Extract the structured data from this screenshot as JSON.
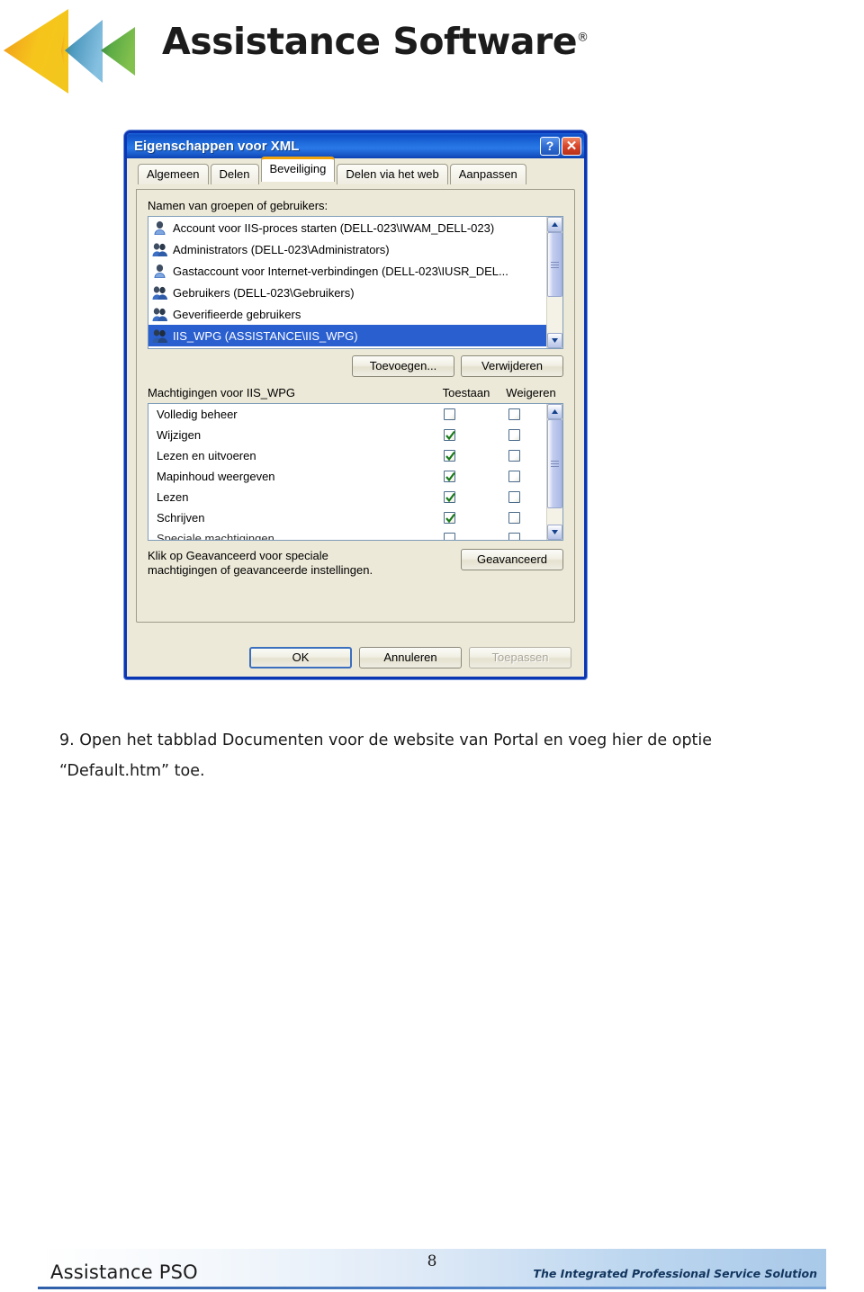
{
  "header": {
    "logo_icon": "assistance-chevron-logo",
    "wordmark": "Assistance Software",
    "registered_mark": "®"
  },
  "dialog": {
    "title": "Eigenschappen voor XML",
    "help_button": "?",
    "close_button": "✕",
    "tabs": [
      {
        "label": "Algemeen",
        "active": false
      },
      {
        "label": "Delen",
        "active": false
      },
      {
        "label": "Beveiliging",
        "active": true
      },
      {
        "label": "Delen via het web",
        "active": false
      },
      {
        "label": "Aanpassen",
        "active": false
      }
    ],
    "groups_label": "Namen van groepen of gebruikers:",
    "groups": [
      {
        "name": "Account voor IIS-proces starten (DELL-023\\IWAM_DELL-023)",
        "icon": "single-user-icon",
        "selected": false
      },
      {
        "name": "Administrators (DELL-023\\Administrators)",
        "icon": "group-users-icon",
        "selected": false
      },
      {
        "name": "Gastaccount voor Internet-verbindingen (DELL-023\\IUSR_DEL...",
        "icon": "single-user-icon",
        "selected": false
      },
      {
        "name": "Gebruikers (DELL-023\\Gebruikers)",
        "icon": "group-users-icon",
        "selected": false
      },
      {
        "name": "Geverifieerde gebruikers",
        "icon": "group-users-icon",
        "selected": false
      },
      {
        "name": "IIS_WPG (ASSISTANCE\\IIS_WPG)",
        "icon": "group-users-icon",
        "selected": true
      }
    ],
    "add_button": "Toevoegen...",
    "remove_button": "Verwijderen",
    "permissions_label": "Machtigingen voor IIS_WPG",
    "col_allow": "Toestaan",
    "col_deny": "Weigeren",
    "permissions": [
      {
        "name": "Volledig beheer",
        "allow": false,
        "deny": false
      },
      {
        "name": "Wijzigen",
        "allow": true,
        "deny": false
      },
      {
        "name": "Lezen en uitvoeren",
        "allow": true,
        "deny": false
      },
      {
        "name": "Mapinhoud weergeven",
        "allow": true,
        "deny": false
      },
      {
        "name": "Lezen",
        "allow": true,
        "deny": false
      },
      {
        "name": "Schrijven",
        "allow": true,
        "deny": false
      },
      {
        "name": "Speciale machtigingen",
        "allow": false,
        "deny": false
      }
    ],
    "advanced_text_line1": "Klik op Geavanceerd voor speciale",
    "advanced_text_line2": "machtigingen of geavanceerde instellingen.",
    "advanced_button": "Geavanceerd",
    "ok_button": "OK",
    "cancel_button": "Annuleren",
    "apply_button": "Toepassen",
    "colors": {
      "titlebar": "#1f6cdd",
      "dialog_border": "#0a36b4",
      "face": "#ece9d8",
      "selection": "#2a5fd0",
      "active_tab_accent": "#f0a30a",
      "checkmark": "#1a7a1a"
    }
  },
  "content": {
    "step_number": "9.",
    "step_text": "Open het tabblad Documenten voor de website van Portal en voeg hier de optie “Default.htm” toe."
  },
  "footer": {
    "brand": "Assistance PSO",
    "page_number": "8",
    "tagline": "The Integrated Professional Service Solution"
  }
}
